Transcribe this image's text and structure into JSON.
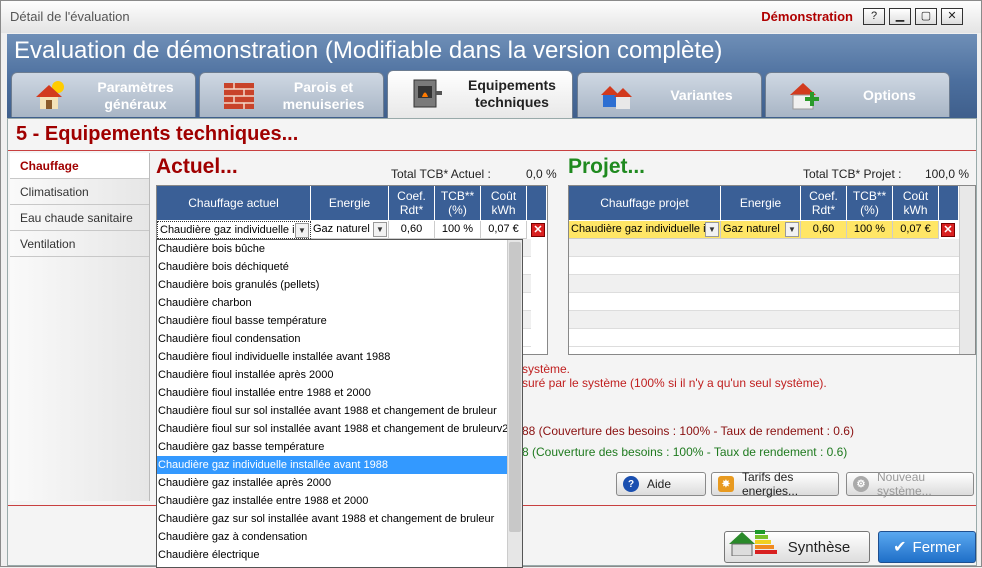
{
  "window": {
    "title": "Détail de l'évaluation",
    "demo_label": "Démonstration"
  },
  "header": {
    "title": "Evaluation de démonstration (Modifiable dans la version complète)"
  },
  "tabs": [
    {
      "label": "Paramètres généraux",
      "icon": "house-sun-icon"
    },
    {
      "label": "Parois et menuiseries",
      "icon": "brick-wall-icon"
    },
    {
      "label": "Equipements techniques",
      "icon": "boiler-icon",
      "active": true
    },
    {
      "label": "Variantes",
      "icon": "houses-icon"
    },
    {
      "label": "Options",
      "icon": "house-plus-icon"
    }
  ],
  "section": {
    "title": "5 - Equipements techniques..."
  },
  "sidenav": [
    {
      "label": "Chauffage",
      "active": true
    },
    {
      "label": "Climatisation"
    },
    {
      "label": "Eau chaude sanitaire"
    },
    {
      "label": "Ventilation"
    }
  ],
  "actuel": {
    "heading": "Actuel...",
    "tcb_label": "Total TCB* Actuel :",
    "tcb_value": "0,0 %",
    "columns": [
      "Chauffage actuel",
      "Energie",
      "Coef. Rdt*",
      "TCB** (%)",
      "Coût kWh"
    ],
    "row": {
      "system": "Chaudière gaz individuelle ins",
      "energy": "Gaz naturel",
      "coef": "0,60",
      "tcb": "100 %",
      "cost": "0,07 €"
    }
  },
  "projet": {
    "heading": "Projet...",
    "tcb_label": "Total TCB* Projet :",
    "tcb_value": "100,0 %",
    "columns": [
      "Chauffage projet",
      "Energie",
      "Coef. Rdt*",
      "TCB** (%)",
      "Coût kWh"
    ],
    "row": {
      "system": "Chaudière gaz individuelle ins",
      "energy": "Gaz naturel",
      "coef": "0,60",
      "tcb": "100 %",
      "cost": "0,07 €"
    }
  },
  "messages": {
    "line1": "système.",
    "line2": "suré par le système (100% si il n'y a qu'un seul système).",
    "actuel": "88 (Couverture des besoins : 100% - Taux de rendement : 0.6)",
    "projet": "8 (Couverture des besoins : 100% - Taux de rendement : 0.6)"
  },
  "buttons": {
    "aide": "Aide",
    "tarifs": "Tarifs des energies...",
    "nouveau": "Nouveau système...",
    "synthese": "Synthèse",
    "fermer": "Fermer"
  },
  "dropdown": {
    "selected_index": 17,
    "options": [
      "Chaudière bois bûche",
      "Chaudière bois déchiqueté",
      "Chaudière bois granulés (pellets)",
      "Chaudière charbon",
      "Chaudière fioul basse température",
      "Chaudière fioul condensation",
      "Chaudière fioul individuelle installée avant 1988",
      "Chaudière fioul installée après 2000",
      "Chaudière fioul installée entre 1988 et 2000",
      "Chaudière fioul sur sol installée avant 1988 et changement de bruleur",
      "Chaudière fioul sur sol installée avant 1988 et changement de bruleurv2",
      "Chaudière gaz basse température",
      "Chaudière gaz individuelle installée avant 1988",
      "Chaudière gaz installée après 2000",
      "Chaudière gaz installée entre 1988 et 2000",
      "Chaudière gaz sur sol installée avant 1988 et changement de bruleur",
      "Chaudière gaz à condensation",
      "Chaudière électrique"
    ]
  },
  "colors": {
    "accent_red": "#a00000",
    "accent_green": "#1f8a1f",
    "header_blue": "#3a5f96",
    "highlight": "#3399ff",
    "row_yellow": "#ffe666"
  }
}
